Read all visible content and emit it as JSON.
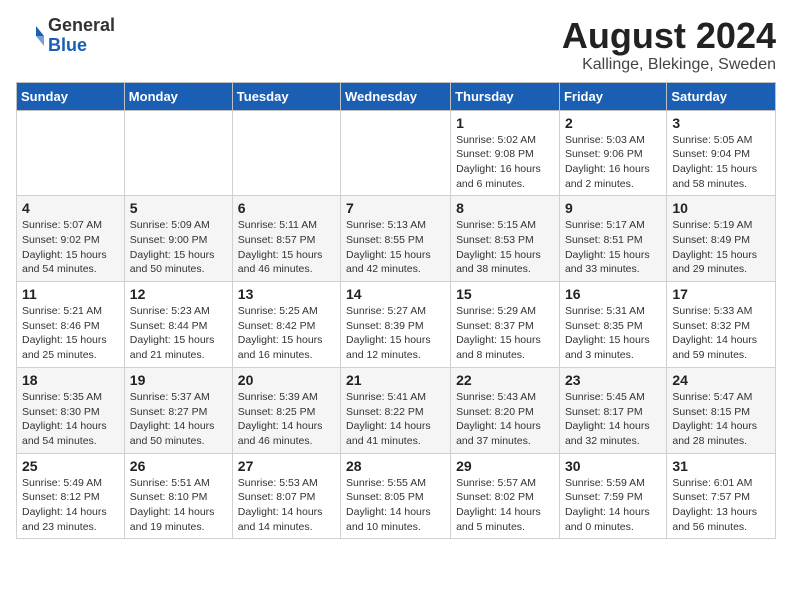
{
  "logo": {
    "general": "General",
    "blue": "Blue"
  },
  "title": {
    "month_year": "August 2024",
    "location": "Kallinge, Blekinge, Sweden"
  },
  "headers": [
    "Sunday",
    "Monday",
    "Tuesday",
    "Wednesday",
    "Thursday",
    "Friday",
    "Saturday"
  ],
  "weeks": [
    [
      {
        "day": "",
        "detail": ""
      },
      {
        "day": "",
        "detail": ""
      },
      {
        "day": "",
        "detail": ""
      },
      {
        "day": "",
        "detail": ""
      },
      {
        "day": "1",
        "detail": "Sunrise: 5:02 AM\nSunset: 9:08 PM\nDaylight: 16 hours\nand 6 minutes."
      },
      {
        "day": "2",
        "detail": "Sunrise: 5:03 AM\nSunset: 9:06 PM\nDaylight: 16 hours\nand 2 minutes."
      },
      {
        "day": "3",
        "detail": "Sunrise: 5:05 AM\nSunset: 9:04 PM\nDaylight: 15 hours\nand 58 minutes."
      }
    ],
    [
      {
        "day": "4",
        "detail": "Sunrise: 5:07 AM\nSunset: 9:02 PM\nDaylight: 15 hours\nand 54 minutes."
      },
      {
        "day": "5",
        "detail": "Sunrise: 5:09 AM\nSunset: 9:00 PM\nDaylight: 15 hours\nand 50 minutes."
      },
      {
        "day": "6",
        "detail": "Sunrise: 5:11 AM\nSunset: 8:57 PM\nDaylight: 15 hours\nand 46 minutes."
      },
      {
        "day": "7",
        "detail": "Sunrise: 5:13 AM\nSunset: 8:55 PM\nDaylight: 15 hours\nand 42 minutes."
      },
      {
        "day": "8",
        "detail": "Sunrise: 5:15 AM\nSunset: 8:53 PM\nDaylight: 15 hours\nand 38 minutes."
      },
      {
        "day": "9",
        "detail": "Sunrise: 5:17 AM\nSunset: 8:51 PM\nDaylight: 15 hours\nand 33 minutes."
      },
      {
        "day": "10",
        "detail": "Sunrise: 5:19 AM\nSunset: 8:49 PM\nDaylight: 15 hours\nand 29 minutes."
      }
    ],
    [
      {
        "day": "11",
        "detail": "Sunrise: 5:21 AM\nSunset: 8:46 PM\nDaylight: 15 hours\nand 25 minutes."
      },
      {
        "day": "12",
        "detail": "Sunrise: 5:23 AM\nSunset: 8:44 PM\nDaylight: 15 hours\nand 21 minutes."
      },
      {
        "day": "13",
        "detail": "Sunrise: 5:25 AM\nSunset: 8:42 PM\nDaylight: 15 hours\nand 16 minutes."
      },
      {
        "day": "14",
        "detail": "Sunrise: 5:27 AM\nSunset: 8:39 PM\nDaylight: 15 hours\nand 12 minutes."
      },
      {
        "day": "15",
        "detail": "Sunrise: 5:29 AM\nSunset: 8:37 PM\nDaylight: 15 hours\nand 8 minutes."
      },
      {
        "day": "16",
        "detail": "Sunrise: 5:31 AM\nSunset: 8:35 PM\nDaylight: 15 hours\nand 3 minutes."
      },
      {
        "day": "17",
        "detail": "Sunrise: 5:33 AM\nSunset: 8:32 PM\nDaylight: 14 hours\nand 59 minutes."
      }
    ],
    [
      {
        "day": "18",
        "detail": "Sunrise: 5:35 AM\nSunset: 8:30 PM\nDaylight: 14 hours\nand 54 minutes."
      },
      {
        "day": "19",
        "detail": "Sunrise: 5:37 AM\nSunset: 8:27 PM\nDaylight: 14 hours\nand 50 minutes."
      },
      {
        "day": "20",
        "detail": "Sunrise: 5:39 AM\nSunset: 8:25 PM\nDaylight: 14 hours\nand 46 minutes."
      },
      {
        "day": "21",
        "detail": "Sunrise: 5:41 AM\nSunset: 8:22 PM\nDaylight: 14 hours\nand 41 minutes."
      },
      {
        "day": "22",
        "detail": "Sunrise: 5:43 AM\nSunset: 8:20 PM\nDaylight: 14 hours\nand 37 minutes."
      },
      {
        "day": "23",
        "detail": "Sunrise: 5:45 AM\nSunset: 8:17 PM\nDaylight: 14 hours\nand 32 minutes."
      },
      {
        "day": "24",
        "detail": "Sunrise: 5:47 AM\nSunset: 8:15 PM\nDaylight: 14 hours\nand 28 minutes."
      }
    ],
    [
      {
        "day": "25",
        "detail": "Sunrise: 5:49 AM\nSunset: 8:12 PM\nDaylight: 14 hours\nand 23 minutes."
      },
      {
        "day": "26",
        "detail": "Sunrise: 5:51 AM\nSunset: 8:10 PM\nDaylight: 14 hours\nand 19 minutes."
      },
      {
        "day": "27",
        "detail": "Sunrise: 5:53 AM\nSunset: 8:07 PM\nDaylight: 14 hours\nand 14 minutes."
      },
      {
        "day": "28",
        "detail": "Sunrise: 5:55 AM\nSunset: 8:05 PM\nDaylight: 14 hours\nand 10 minutes."
      },
      {
        "day": "29",
        "detail": "Sunrise: 5:57 AM\nSunset: 8:02 PM\nDaylight: 14 hours\nand 5 minutes."
      },
      {
        "day": "30",
        "detail": "Sunrise: 5:59 AM\nSunset: 7:59 PM\nDaylight: 14 hours\nand 0 minutes."
      },
      {
        "day": "31",
        "detail": "Sunrise: 6:01 AM\nSunset: 7:57 PM\nDaylight: 13 hours\nand 56 minutes."
      }
    ]
  ]
}
